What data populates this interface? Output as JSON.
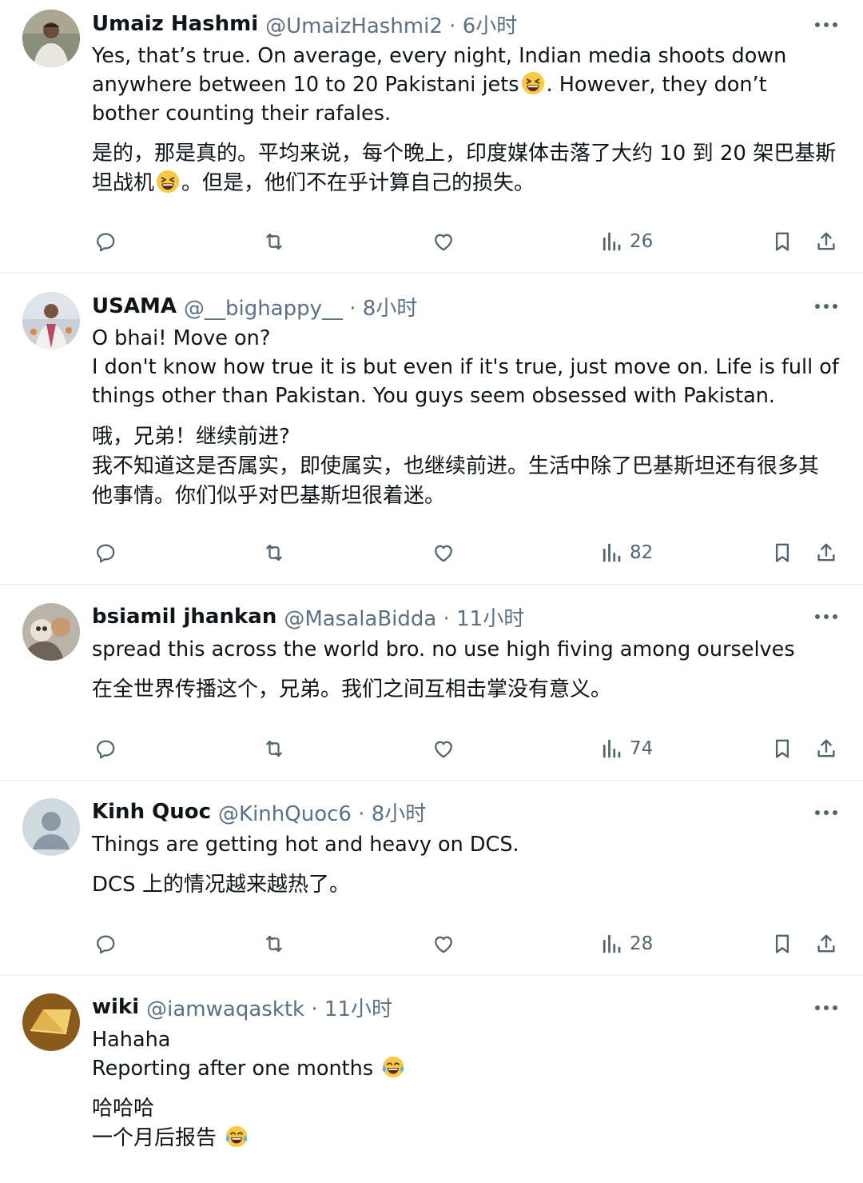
{
  "colors": {
    "text": "#0f1419",
    "secondary": "#5b7083",
    "icon": "#536471",
    "divider": "#e8ebed"
  },
  "posts": [
    {
      "name": "Umaiz Hashmi",
      "handle": "@UmaizHashmi2 · 6小时",
      "en_1": "Yes, that’s true. On average, every night, Indian media shoots down anywhere between 10 to 20 Pakistani jets",
      "en_emoji": "grinning-squinting-face",
      "en_2": ". However, they don’t bother counting their rafales.",
      "zh_1": "是的，那是真的。平均来说，每个晚上，印度媒体击落了大约 10 到 20 架巴基斯坦战机",
      "zh_emoji": "grinning-squinting-face",
      "zh_2": "。但是，他们不在乎计算自己的损失。",
      "views": "26"
    },
    {
      "name": "USAMA",
      "handle": "@__bighappy__ · 8小时",
      "en_line1": "O bhai! Move on?",
      "en_line2": "I don't know how true it is but even if it's true, just move on. Life is full of things other than Pakistan. You guys seem obsessed with Pakistan.",
      "zh_line1": "哦，兄弟！继续前进?",
      "zh_line2": "我不知道这是否属实，即使属实，也继续前进。生活中除了巴基斯坦还有很多其他事情。你们似乎对巴基斯坦很着迷。",
      "views": "82"
    },
    {
      "name": "bsiamil jhankan",
      "handle": "@MasalaBidda · 11小时",
      "en_line1": "spread this across the world bro. no use high fiving among ourselves",
      "zh_line1": "在全世界传播这个，兄弟。我们之间互相击掌没有意义。",
      "views": "74"
    },
    {
      "name": "Kinh Quoc",
      "handle": "@KinhQuoc6 · 8小时",
      "en_line1": "Things are getting hot and heavy on DCS.",
      "zh_line1": "DCS 上的情况越来越热了。",
      "views": "28"
    },
    {
      "name": "wiki",
      "handle": "@iamwaqasktk · 11小时",
      "en_line1": "Hahaha",
      "en_line2": "Reporting after one months",
      "en_emoji": "face-with-tears-of-joy",
      "zh_line1": "哈哈哈",
      "zh_line2": "一个月后报告",
      "zh_emoji": "face-with-tears-of-joy"
    }
  ]
}
